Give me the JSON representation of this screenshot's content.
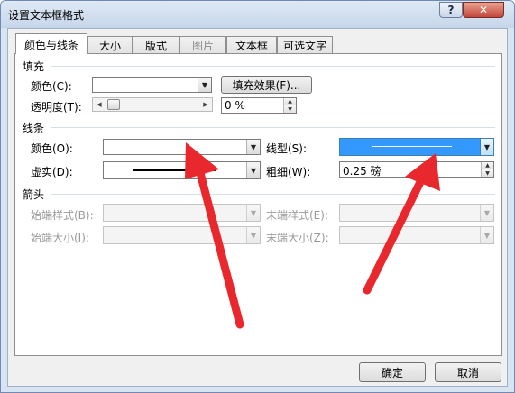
{
  "window": {
    "title": "设置文本框格式",
    "help_label": "?",
    "close_label": "✕"
  },
  "tabs": [
    {
      "label": "颜色与线条",
      "active": true
    },
    {
      "label": "大小"
    },
    {
      "label": "版式"
    },
    {
      "label": "图片",
      "disabled": true
    },
    {
      "label": "文本框"
    },
    {
      "label": "可选文字"
    }
  ],
  "fill": {
    "heading": "填充",
    "color_label": "颜色(C):",
    "color_value": "",
    "effects_button": "填充效果(F)...",
    "transparency_label": "透明度(T):",
    "transparency_value": "0 %",
    "transparency_percent": 0
  },
  "line": {
    "heading": "线条",
    "color_label": "颜色(O):",
    "color_value": "",
    "dash_label": "虚实(D):",
    "style_label": "线型(S):",
    "weight_label": "粗细(W):",
    "weight_value": "0.25 磅"
  },
  "arrows": {
    "heading": "箭头",
    "begin_style_label": "始端样式(B):",
    "begin_size_label": "始端大小(I):",
    "end_style_label": "末端样式(E):",
    "end_size_label": "末端大小(Z):"
  },
  "footer": {
    "ok_label": "确定",
    "cancel_label": "取消"
  },
  "colors": {
    "selection": "#3399ff",
    "annotation_arrow": "#e8282d",
    "dialog_bg": "#f0f0f0"
  }
}
